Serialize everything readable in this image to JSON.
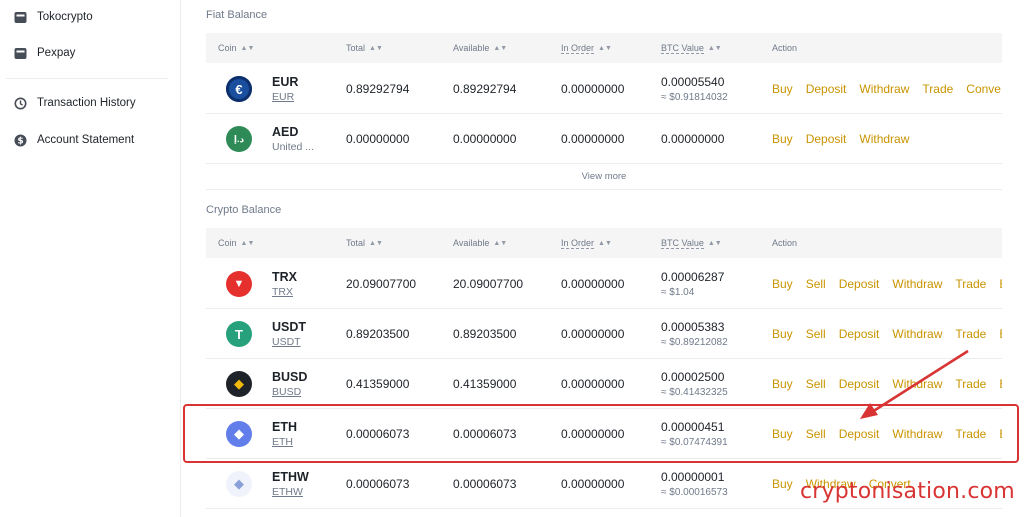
{
  "sidebar": {
    "items": [
      {
        "label": "Tokocrypto",
        "icon": "wallet-icon"
      },
      {
        "label": "Pexpay",
        "icon": "wallet-icon"
      },
      {
        "label": "Transaction History",
        "icon": "history-icon"
      },
      {
        "label": "Account Statement",
        "icon": "dollar-icon"
      }
    ]
  },
  "fiat": {
    "title": "Fiat Balance",
    "headers": {
      "coin": "Coin",
      "total": "Total",
      "available": "Available",
      "in_order": "In Order",
      "btc_value": "BTC Value",
      "action": "Action"
    },
    "rows": [
      {
        "symbol": "EUR",
        "name": "EUR",
        "icon_glyph": "€",
        "icon_color": "#1a4fa0",
        "total": "0.89292794",
        "available": "0.89292794",
        "in_order": "0.00000000",
        "btc": "0.00005540",
        "usd": "≈ $0.91814032",
        "actions": [
          "Buy",
          "Deposit",
          "Withdraw",
          "Trade",
          "Conve"
        ]
      },
      {
        "symbol": "AED",
        "name": "United ...",
        "icon_glyph": "د.إ",
        "icon_color": "#2e8b57",
        "total": "0.00000000",
        "available": "0.00000000",
        "in_order": "0.00000000",
        "btc": "0.00000000",
        "usd": "",
        "actions": [
          "Buy",
          "Deposit",
          "Withdraw"
        ]
      }
    ],
    "view_more": "View more"
  },
  "crypto": {
    "title": "Crypto Balance",
    "headers": {
      "coin": "Coin",
      "total": "Total",
      "available": "Available",
      "in_order": "In Order",
      "btc_value": "BTC Value",
      "action": "Action"
    },
    "rows": [
      {
        "symbol": "TRX",
        "name": "TRX",
        "icon_glyph": "▼",
        "icon_color": "#e5302e",
        "total": "20.09007700",
        "available": "20.09007700",
        "in_order": "0.00000000",
        "btc": "0.00006287",
        "usd": "≈ $1.04",
        "actions": [
          "Buy",
          "Sell",
          "Deposit",
          "Withdraw",
          "Trade",
          "Ea"
        ]
      },
      {
        "symbol": "USDT",
        "name": "USDT",
        "icon_glyph": "T",
        "icon_color": "#26a17b",
        "total": "0.89203500",
        "available": "0.89203500",
        "in_order": "0.00000000",
        "btc": "0.00005383",
        "usd": "≈ $0.89212082",
        "actions": [
          "Buy",
          "Sell",
          "Deposit",
          "Withdraw",
          "Trade",
          "Ea"
        ]
      },
      {
        "symbol": "BUSD",
        "name": "BUSD",
        "icon_glyph": "◆",
        "icon_color": "#1e2329",
        "total": "0.41359000",
        "available": "0.41359000",
        "in_order": "0.00000000",
        "btc": "0.00002500",
        "usd": "≈ $0.41432325",
        "actions": [
          "Buy",
          "Sell",
          "Deposit",
          "Withdraw",
          "Trade",
          "Ea"
        ]
      },
      {
        "symbol": "ETH",
        "name": "ETH",
        "icon_glyph": "◆",
        "icon_color": "#627eea",
        "total": "0.00006073",
        "available": "0.00006073",
        "in_order": "0.00000000",
        "btc": "0.00000451",
        "usd": "≈ $0.07474391",
        "actions": [
          "Buy",
          "Sell",
          "Deposit",
          "Withdraw",
          "Trade",
          "Ea"
        ]
      },
      {
        "symbol": "ETHW",
        "name": "ETHW",
        "icon_glyph": "◆",
        "icon_color": "#8aa0d8",
        "total": "0.00006073",
        "available": "0.00006073",
        "in_order": "0.00000000",
        "btc": "0.00000001",
        "usd": "≈ $0.00016573",
        "actions": [
          "Buy",
          "Withdraw",
          "Convert"
        ]
      }
    ]
  },
  "annotation": {
    "watermark": "cryptonisation.com",
    "highlight_color": "#d93434"
  },
  "colors": {
    "action_link": "#c99400",
    "header_bg": "#f5f5f5",
    "muted_text": "#707a8a"
  }
}
